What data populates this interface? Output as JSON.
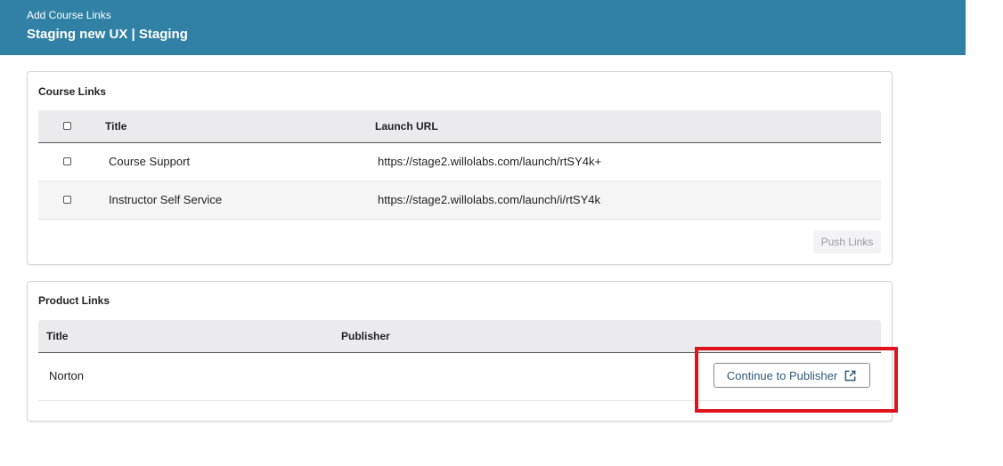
{
  "header": {
    "subtitle": "Add Course Links",
    "title": "Staging new UX | Staging"
  },
  "course_links": {
    "title": "Course Links",
    "columns": [
      "Title",
      "Launch URL"
    ],
    "rows": [
      {
        "title": "Course Support",
        "url": "https://stage2.willolabs.com/launch/rtSY4k+"
      },
      {
        "title": "Instructor Self Service",
        "url": "https://stage2.willolabs.com/launch/i/rtSY4k"
      }
    ],
    "push_button": "Push Links"
  },
  "product_links": {
    "title": "Product Links",
    "columns": [
      "Title",
      "Publisher"
    ],
    "rows": [
      {
        "title": "Norton",
        "publisher": ""
      }
    ],
    "continue_button": "Continue to Publisher",
    "continue_icon": "external-link-icon"
  },
  "colors": {
    "header_bg": "#3180a5",
    "highlight": "#e0141e"
  }
}
